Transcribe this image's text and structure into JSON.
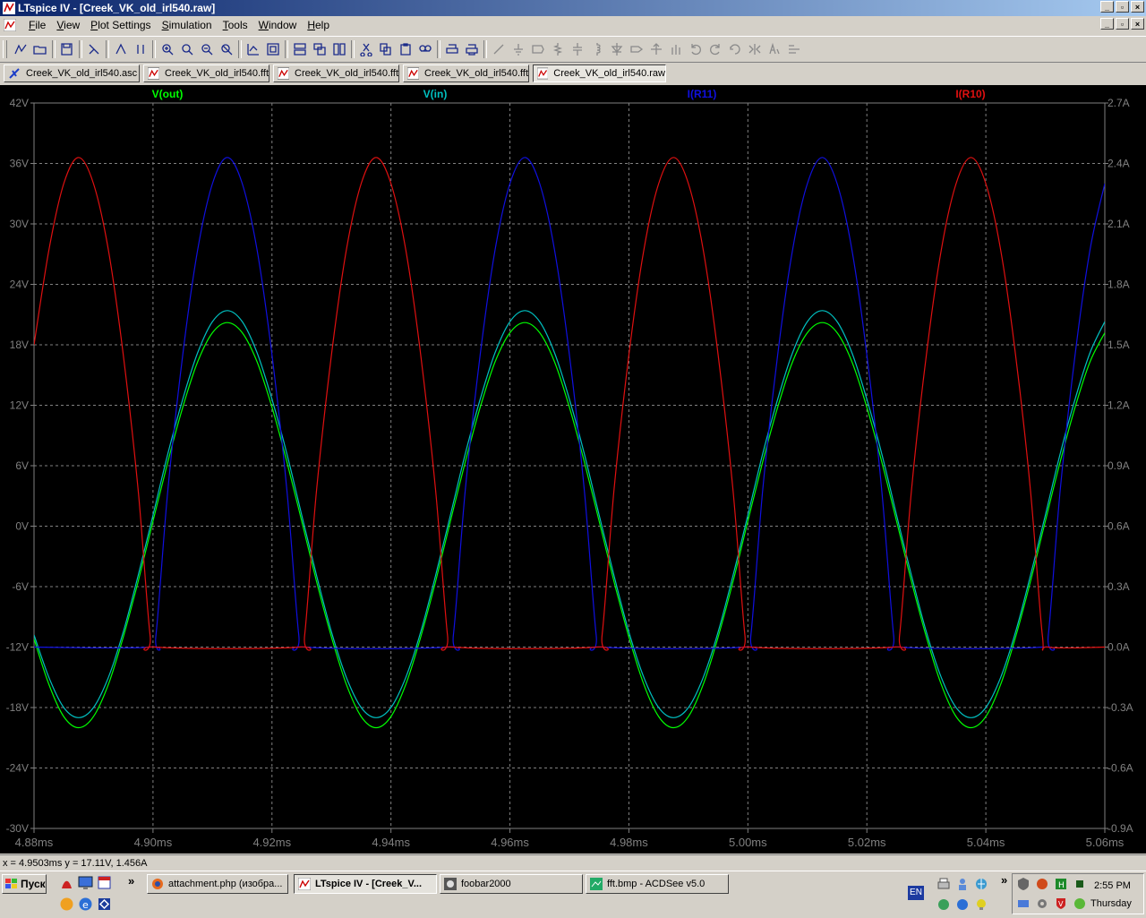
{
  "window": {
    "title": "LTspice IV - [Creek_VK_old_irl540.raw]"
  },
  "menu": [
    "File",
    "View",
    "Plot Settings",
    "Simulation",
    "Tools",
    "Window",
    "Help"
  ],
  "toolbar_icons": [
    "new-schematic",
    "open-file",
    "|",
    "save",
    "|",
    "control-panel",
    "|",
    "run",
    "halt",
    "|",
    "zoom-in",
    "zoom-pan",
    "zoom-out",
    "zoom-cancel",
    "|",
    "autorange",
    "zoom-to-fit",
    "|",
    "tile-horizontal",
    "cascade",
    "tile-vertical",
    "|",
    "cut",
    "copy",
    "paste",
    "find",
    "|",
    "print-setup",
    "print",
    "|",
    "wire",
    "ground",
    "label-net",
    "resistor",
    "capacitor",
    "inductor",
    "diode",
    "component",
    "move",
    "drag",
    "undo",
    "redo",
    "rotate",
    "mirror",
    "text",
    "spice-directive"
  ],
  "tabs": [
    {
      "label": "Creek_VK_old_irl540.asc",
      "icon": "schematic-icon",
      "active": false
    },
    {
      "label": "Creek_VK_old_irl540.fft",
      "icon": "waveform-icon",
      "active": false
    },
    {
      "label": "Creek_VK_old_irl540.fft",
      "icon": "waveform-icon",
      "active": false
    },
    {
      "label": "Creek_VK_old_irl540.fft",
      "icon": "waveform-icon",
      "active": false
    },
    {
      "label": "Creek_VK_old_irl540.raw",
      "icon": "waveform-icon",
      "active": true
    }
  ],
  "status": {
    "cursor_readout": "x = 4.9503ms    y = 17.11V, 1.456A"
  },
  "chart_data": {
    "type": "line",
    "background": "#000000",
    "grid": true,
    "x_unit": "ms",
    "xlim": [
      4.88,
      5.06
    ],
    "x_ticks": [
      "4.88ms",
      "4.90ms",
      "4.92ms",
      "4.94ms",
      "4.96ms",
      "4.98ms",
      "5.00ms",
      "5.02ms",
      "5.04ms",
      "5.06ms"
    ],
    "y_left": {
      "ylim": [
        -30,
        42
      ],
      "ticks": [
        "42V",
        "36V",
        "30V",
        "24V",
        "18V",
        "12V",
        "6V",
        "0V",
        "-6V",
        "-12V",
        "-18V",
        "-24V",
        "-30V"
      ]
    },
    "y_right": {
      "ylim": [
        -0.9,
        2.7
      ],
      "ticks": [
        "2.7A",
        "2.4A",
        "2.1A",
        "1.8A",
        "1.5A",
        "1.2A",
        "0.9A",
        "0.6A",
        "0.3A",
        "0.0A",
        "-0.3A",
        "-0.6A",
        "-0.9A"
      ]
    },
    "series": [
      {
        "name": "V(out)",
        "axis": "left",
        "color": "#00ff00",
        "x": [
          4.88,
          4.8825,
          4.885,
          4.8875,
          4.89,
          4.8925,
          4.895,
          4.8975,
          4.9,
          4.9025,
          4.905,
          4.9075,
          4.91,
          4.9125,
          4.915,
          4.9175,
          4.92,
          4.9225,
          4.925,
          4.9275,
          4.93,
          4.9325,
          4.935,
          4.9375,
          4.94,
          4.9425,
          4.945,
          4.9475,
          4.95,
          4.9525,
          4.955,
          4.9575,
          4.96,
          4.9625,
          4.965,
          4.9675,
          4.97,
          4.9725,
          4.975,
          4.9775,
          4.98,
          4.9825,
          4.985,
          4.9875,
          4.99,
          4.9925,
          4.995,
          4.9975,
          5.0,
          5.0025,
          5.005,
          5.0075,
          5.01,
          5.0125,
          5.015,
          5.0175,
          5.02,
          5.0225,
          5.025,
          5.0275,
          5.03,
          5.0325,
          5.035,
          5.0375,
          5.04,
          5.0425,
          5.045,
          5.0475,
          5.05,
          5.0525,
          5.055,
          5.0575,
          5.06
        ],
        "values": [
          -11.2,
          -15.7,
          -18.9,
          -20.0,
          -18.9,
          -15.7,
          -11.0,
          -5.5,
          0.5,
          6.4,
          11.8,
          16.3,
          19.2,
          20.2,
          19.2,
          16.3,
          11.8,
          6.4,
          0.5,
          -5.5,
          -11.0,
          -15.7,
          -18.9,
          -20.0,
          -18.9,
          -15.7,
          -11.0,
          -5.5,
          0.5,
          6.4,
          11.8,
          16.3,
          19.2,
          20.2,
          19.2,
          16.3,
          11.8,
          6.4,
          0.5,
          -5.5,
          -11.0,
          -15.7,
          -18.9,
          -20.0,
          -18.9,
          -15.7,
          -11.0,
          -5.5,
          0.5,
          6.4,
          11.8,
          16.3,
          19.2,
          20.2,
          19.2,
          16.3,
          11.8,
          6.4,
          0.5,
          -5.5,
          -11.0,
          -15.7,
          -18.9,
          -20.0,
          -18.9,
          -15.7,
          -11.0,
          -5.5,
          0.5,
          6.4,
          11.8,
          16.3,
          19.2
        ]
      },
      {
        "name": "V(in)",
        "axis": "left",
        "color": "#00c0c0",
        "x": [
          4.88,
          4.8825,
          4.885,
          4.8875,
          4.89,
          4.8925,
          4.895,
          4.8975,
          4.9,
          4.9025,
          4.905,
          4.9075,
          4.91,
          4.9125,
          4.915,
          4.9175,
          4.92,
          4.9225,
          4.925,
          4.9275,
          4.93,
          4.9325,
          4.935,
          4.9375,
          4.94,
          4.9425,
          4.945,
          4.9475,
          4.95,
          4.9525,
          4.955,
          4.9575,
          4.96,
          4.9625,
          4.965,
          4.9675,
          4.97,
          4.9725,
          4.975,
          4.9775,
          4.98,
          4.9825,
          4.985,
          4.9875,
          4.99,
          4.9925,
          4.995,
          4.9975,
          5.0,
          5.0025,
          5.005,
          5.0075,
          5.01,
          5.0125,
          5.015,
          5.0175,
          5.02,
          5.0225,
          5.025,
          5.0275,
          5.03,
          5.0325,
          5.035,
          5.0375,
          5.04,
          5.0425,
          5.045,
          5.0475,
          5.05,
          5.0525,
          5.055,
          5.0575,
          5.06
        ],
        "values": [
          -10.8,
          -15.0,
          -18.0,
          -19.0,
          -18.0,
          -15.0,
          -10.5,
          -4.9,
          1.1,
          7.2,
          12.6,
          17.2,
          20.3,
          21.4,
          20.3,
          17.2,
          12.6,
          7.2,
          1.1,
          -4.9,
          -10.5,
          -15.0,
          -18.0,
          -19.0,
          -18.0,
          -15.0,
          -10.5,
          -4.9,
          1.1,
          7.2,
          12.6,
          17.2,
          20.3,
          21.4,
          20.3,
          17.2,
          12.6,
          7.2,
          1.1,
          -4.9,
          -10.5,
          -15.0,
          -18.0,
          -19.0,
          -18.0,
          -15.0,
          -10.5,
          -4.9,
          1.1,
          7.2,
          12.6,
          17.2,
          20.3,
          21.4,
          20.3,
          17.2,
          12.6,
          7.2,
          1.1,
          -4.9,
          -10.5,
          -15.0,
          -18.0,
          -19.0,
          -18.0,
          -15.0,
          -10.5,
          -4.9,
          1.1,
          7.2,
          12.6,
          17.2,
          20.3
        ]
      },
      {
        "name": "I(R11)",
        "axis": "right",
        "color": "#1010e0",
        "x": [
          4.88,
          4.8995,
          4.9005,
          4.9025,
          4.905,
          4.9075,
          4.91,
          4.9125,
          4.915,
          4.9175,
          4.92,
          4.9225,
          4.9245,
          4.9255,
          4.9495,
          4.9505,
          4.9525,
          4.955,
          4.9575,
          4.96,
          4.9625,
          4.965,
          4.9675,
          4.97,
          4.9725,
          4.9745,
          4.9755,
          4.9995,
          5.0005,
          5.0025,
          5.005,
          5.0075,
          5.01,
          5.0125,
          5.015,
          5.0175,
          5.02,
          5.0225,
          5.0245,
          5.0255,
          5.0495,
          5.0505,
          5.0525,
          5.055,
          5.0575,
          5.06
        ],
        "values": [
          0.0,
          0.0,
          0.06,
          0.78,
          1.45,
          1.97,
          2.3,
          2.43,
          2.3,
          1.97,
          1.45,
          0.78,
          0.06,
          0.0,
          0.0,
          0.06,
          0.78,
          1.45,
          1.97,
          2.3,
          2.43,
          2.3,
          1.97,
          1.45,
          0.78,
          0.06,
          0.0,
          0.0,
          0.06,
          0.78,
          1.45,
          1.97,
          2.3,
          2.43,
          2.3,
          1.97,
          1.45,
          0.78,
          0.06,
          0.0,
          0.0,
          0.06,
          0.78,
          1.45,
          1.97,
          2.3
        ]
      },
      {
        "name": "I(R10)",
        "axis": "right",
        "color": "#e01010",
        "x": [
          4.88,
          4.8825,
          4.885,
          4.8875,
          4.89,
          4.8925,
          4.895,
          4.8975,
          4.8995,
          4.9005,
          4.9245,
          4.9255,
          4.9275,
          4.93,
          4.9325,
          4.935,
          4.9375,
          4.94,
          4.9425,
          4.945,
          4.9475,
          4.9495,
          4.9505,
          4.9745,
          4.9755,
          4.9775,
          4.98,
          4.9825,
          4.985,
          4.9875,
          4.99,
          4.9925,
          4.995,
          4.9975,
          4.9995,
          5.0005,
          5.0245,
          5.0255,
          5.0275,
          5.03,
          5.0325,
          5.035,
          5.0375,
          5.04,
          5.0425,
          5.045,
          5.0475,
          5.0495,
          5.0505,
          5.06
        ],
        "values": [
          1.5,
          1.97,
          2.3,
          2.43,
          2.3,
          1.97,
          1.45,
          0.78,
          0.06,
          0.0,
          0.0,
          0.06,
          0.78,
          1.45,
          1.97,
          2.3,
          2.43,
          2.3,
          1.97,
          1.45,
          0.78,
          0.06,
          0.0,
          0.0,
          0.06,
          0.78,
          1.45,
          1.97,
          2.3,
          2.43,
          2.3,
          1.97,
          1.45,
          0.78,
          0.06,
          0.0,
          0.0,
          0.06,
          0.78,
          1.45,
          1.97,
          2.3,
          2.43,
          2.3,
          1.97,
          1.45,
          0.78,
          0.06,
          0.0,
          0.0
        ]
      }
    ]
  },
  "taskbar": {
    "start_label": "Пуск",
    "buttons": [
      {
        "label": "attachment.php (изобра...",
        "icon": "firefox-icon",
        "active": false
      },
      {
        "label": "LTspice IV - [Creek_V...",
        "icon": "ltspice-icon",
        "active": true
      },
      {
        "label": "foobar2000",
        "icon": "foobar-icon",
        "active": false
      },
      {
        "label": "fft.bmp - ACDSee v5.0",
        "icon": "acdsee-icon",
        "active": false
      }
    ],
    "language": "EN",
    "clock_time": "2:55 PM",
    "clock_day": "Thursday"
  }
}
